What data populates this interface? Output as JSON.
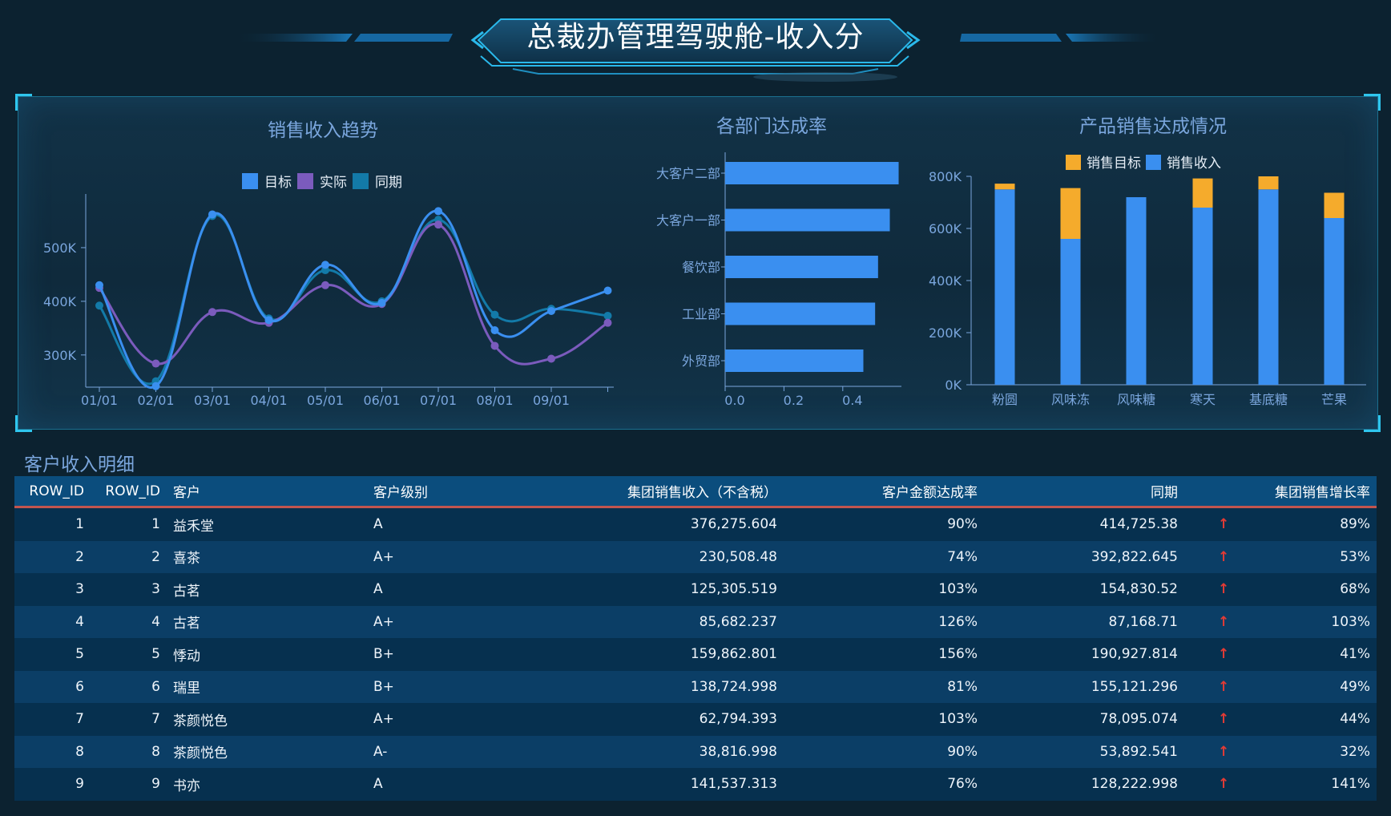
{
  "header": {
    "title": "总裁办管理驾驶舱-收入分"
  },
  "trend": {
    "title": "销售收入趋势",
    "legend": [
      "目标",
      "实际",
      "同期"
    ],
    "colors": [
      "#3a8ff0",
      "#7b5bbd",
      "#137aa8"
    ],
    "y_ticks": [
      "300K",
      "400K",
      "500K"
    ],
    "x_ticks": [
      "01/01",
      "02/01",
      "03/01",
      "04/01",
      "05/01",
      "06/01",
      "07/01",
      "08/01",
      "09/01"
    ]
  },
  "dept": {
    "title": "各部门达成率",
    "categories": [
      "大客户二部",
      "大客户一部",
      "餐饮部",
      "工业部",
      "外贸部"
    ],
    "x_ticks": [
      "0.0",
      "0.2",
      "0.4"
    ]
  },
  "product": {
    "title": "产品销售达成情况",
    "legend": [
      "销售目标",
      "销售收入"
    ],
    "colors": [
      "#f5ab2c",
      "#3a8ff0"
    ],
    "y_ticks": [
      "0K",
      "200K",
      "400K",
      "600K",
      "800K"
    ],
    "categories": [
      "粉圆",
      "风味冻",
      "风味糖",
      "寒天",
      "基底糖",
      "芒果"
    ]
  },
  "chart_data": [
    {
      "type": "line",
      "title": "销售收入趋势",
      "x": [
        "01/01",
        "02/01",
        "03/01",
        "04/01",
        "05/01",
        "06/01",
        "07/01",
        "08/01",
        "09/01",
        ""
      ],
      "ylim": [
        240000,
        600000
      ],
      "series": [
        {
          "name": "目标",
          "values": [
            430000,
            242000,
            562000,
            365000,
            468000,
            397000,
            568000,
            346000,
            382000,
            420000
          ]
        },
        {
          "name": "实际",
          "values": [
            425000,
            284000,
            380000,
            360000,
            430000,
            395000,
            543000,
            317000,
            293000,
            360000
          ]
        },
        {
          "name": "同期",
          "values": [
            392000,
            251000,
            559000,
            368000,
            458000,
            400000,
            552000,
            375000,
            386000,
            373000
          ]
        }
      ]
    },
    {
      "type": "bar",
      "title": "各部门达成率",
      "orientation": "horizontal",
      "categories": [
        "大客户二部",
        "大客户一部",
        "餐饮部",
        "工业部",
        "外贸部"
      ],
      "values": [
        0.59,
        0.56,
        0.52,
        0.51,
        0.47
      ],
      "xlim": [
        0,
        0.6
      ]
    },
    {
      "type": "bar",
      "title": "产品销售达成情况",
      "stacked": true,
      "categories": [
        "粉圆",
        "风味冻",
        "风味糖",
        "寒天",
        "基底糖",
        "芒果"
      ],
      "ylim": [
        0,
        800000
      ],
      "series": [
        {
          "name": "销售收入",
          "values": [
            750000,
            560000,
            720000,
            680000,
            750000,
            640000
          ]
        },
        {
          "name": "销售目标",
          "values": [
            22000,
            195000,
            0,
            112000,
            50000,
            97000
          ]
        }
      ]
    }
  ],
  "table": {
    "section_title": "客户收入明细",
    "headers": [
      "ROW_ID",
      "ROW_ID",
      "客户",
      "客户级别",
      "集团销售收入（不含税）",
      "客户金额达成率",
      "同期",
      "集团销售增长率"
    ],
    "arrow": "↑",
    "rows": [
      [
        "1",
        "1",
        "益禾堂",
        "A",
        "376,275.604",
        "90%",
        "414,725.38",
        "89%"
      ],
      [
        "2",
        "2",
        "喜茶",
        "A+",
        "230,508.48",
        "74%",
        "392,822.645",
        "53%"
      ],
      [
        "3",
        "3",
        "古茗",
        "A",
        "125,305.519",
        "103%",
        "154,830.52",
        "68%"
      ],
      [
        "4",
        "4",
        "古茗",
        "A+",
        "85,682.237",
        "126%",
        "87,168.71",
        "103%"
      ],
      [
        "5",
        "5",
        "悸动",
        "B+",
        "159,862.801",
        "156%",
        "190,927.814",
        "41%"
      ],
      [
        "6",
        "6",
        "瑞里",
        "B+",
        "138,724.998",
        "81%",
        "155,121.296",
        "49%"
      ],
      [
        "7",
        "7",
        "茶颜悦色",
        "A+",
        "62,794.393",
        "103%",
        "78,095.074",
        "44%"
      ],
      [
        "8",
        "8",
        "茶颜悦色",
        "A-",
        "38,816.998",
        "90%",
        "53,892.541",
        "32%"
      ],
      [
        "9",
        "9",
        "书亦",
        "A",
        "141,537.313",
        "76%",
        "128,222.998",
        "141%"
      ]
    ]
  }
}
